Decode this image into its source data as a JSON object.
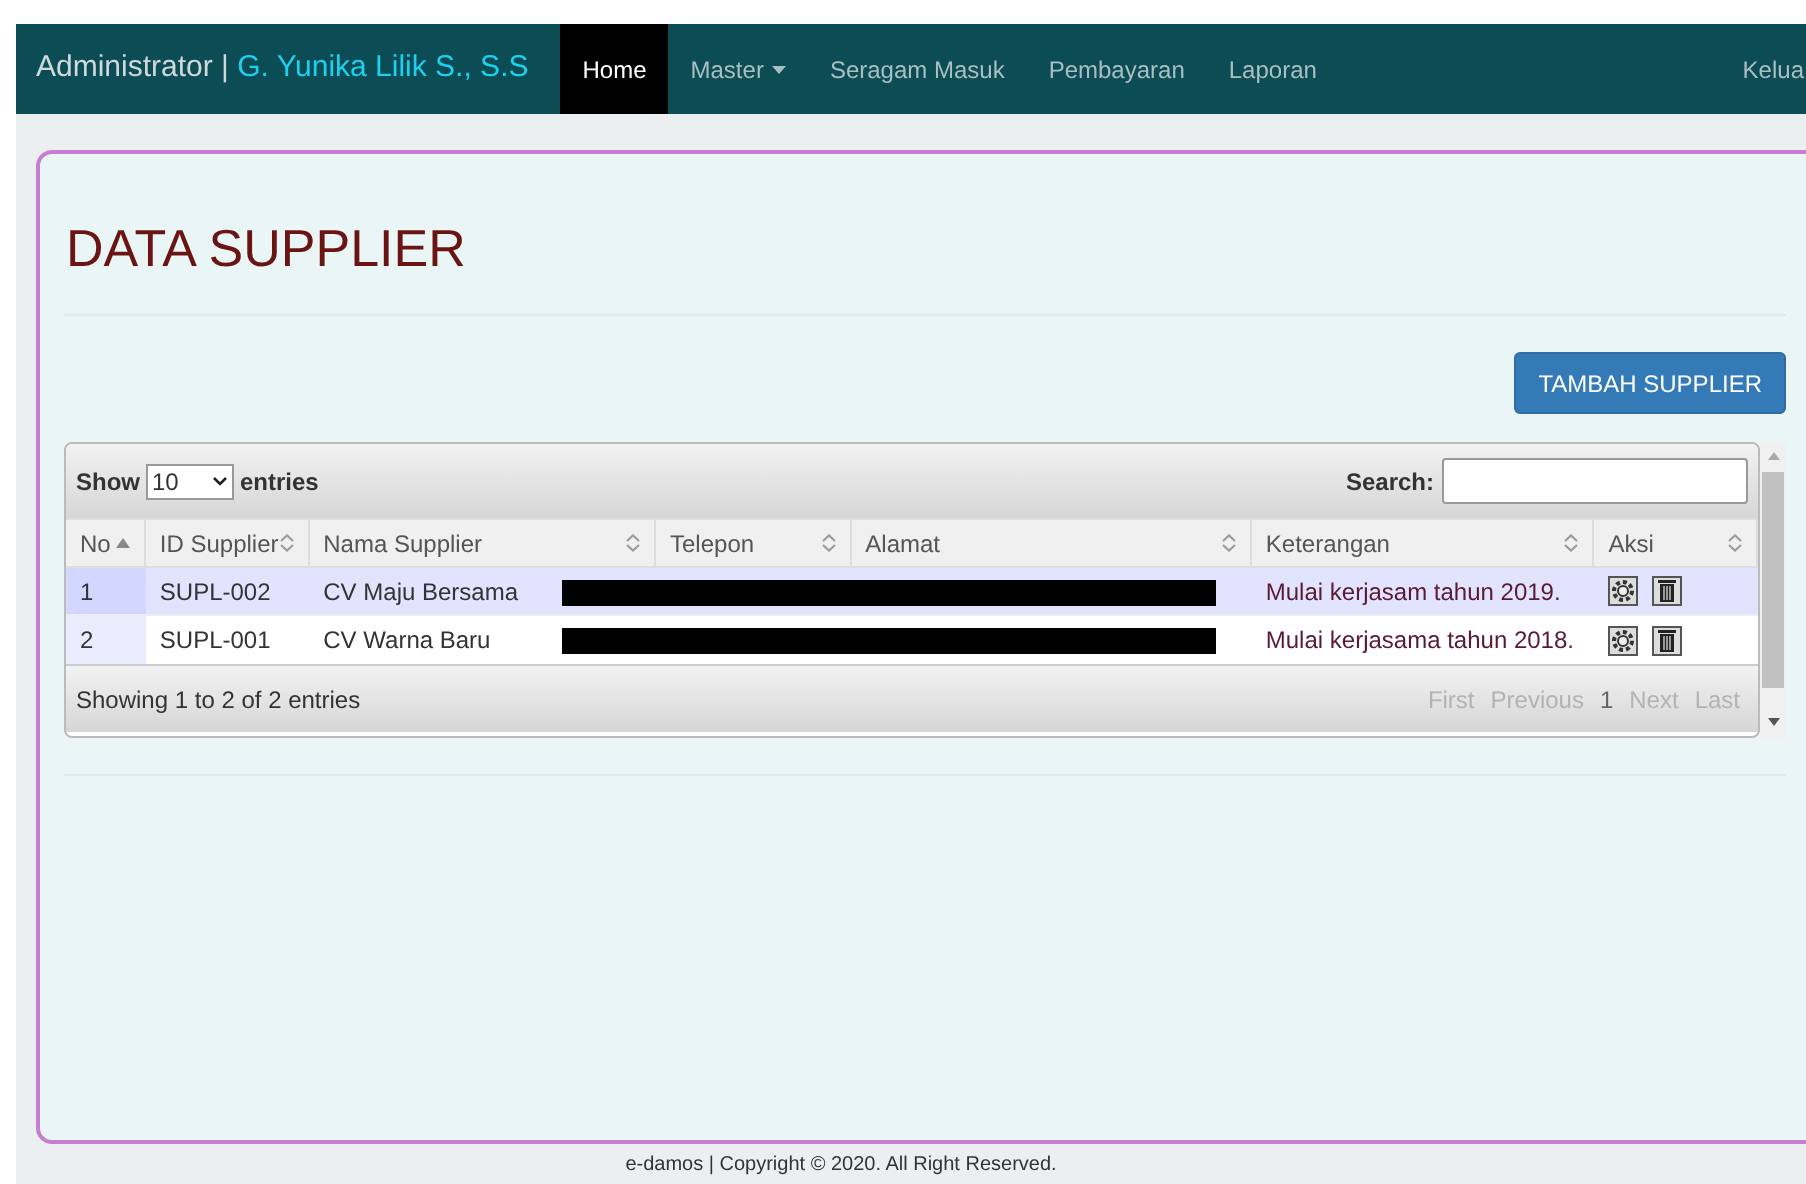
{
  "navbar": {
    "brand": "Administrator | ",
    "user": "G. Yunika Lilik S., S.S",
    "items": [
      {
        "label": "Home",
        "selected": true,
        "dropdown": false
      },
      {
        "label": "Master",
        "selected": false,
        "dropdown": true
      },
      {
        "label": "Seragam Masuk",
        "selected": false,
        "dropdown": false
      },
      {
        "label": "Pembayaran",
        "selected": false,
        "dropdown": false
      },
      {
        "label": "Laporan",
        "selected": false,
        "dropdown": false
      }
    ],
    "right_link": "Kelua"
  },
  "page": {
    "title": "DATA SUPPLIER",
    "add_button": "TAMBAH SUPPLIER"
  },
  "table": {
    "length": {
      "show": "Show",
      "value": "10",
      "entries": "entries"
    },
    "search_label": "Search:",
    "columns": [
      {
        "label": "No",
        "sorted": true
      },
      {
        "label": "ID Supplier",
        "sorted": false
      },
      {
        "label": "Nama Supplier",
        "sorted": false
      },
      {
        "label": "Telepon",
        "sorted": false
      },
      {
        "label": "Alamat",
        "sorted": false
      },
      {
        "label": "Keterangan",
        "sorted": false
      },
      {
        "label": "Aksi",
        "sorted": false
      }
    ],
    "rows": [
      {
        "no": "1",
        "id": "SUPL-002",
        "nama": "CV Maju Bersama",
        "keterangan": "Mulai kerjasam tahun 2019."
      },
      {
        "no": "2",
        "id": "SUPL-001",
        "nama": "CV Warna Baru",
        "keterangan": "Mulai kerjasama tahun 2018."
      }
    ],
    "info": "Showing 1 to 2 of 2 entries",
    "pagination": [
      {
        "label": "First",
        "disabled": true
      },
      {
        "label": "Previous",
        "disabled": true
      },
      {
        "label": "1",
        "disabled": false
      },
      {
        "label": "Next",
        "disabled": true
      },
      {
        "label": "Last",
        "disabled": true
      }
    ]
  },
  "footer": "e-damos | Copyright © 2020. All Right Reserved."
}
